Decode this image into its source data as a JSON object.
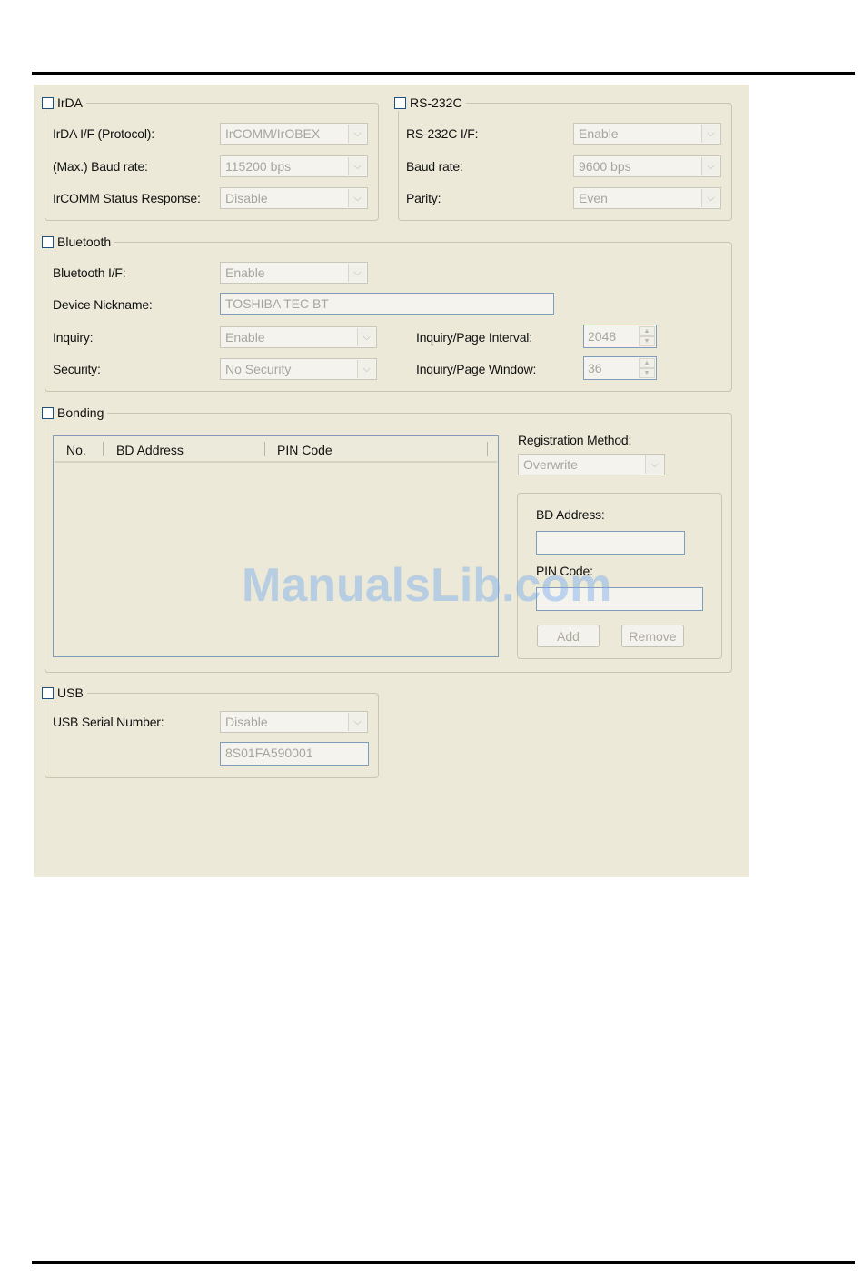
{
  "irda": {
    "title": "IrDA",
    "protocol_label": "IrDA I/F (Protocol):",
    "protocol_value": "IrCOMM/IrOBEX",
    "baud_label": "(Max.) Baud rate:",
    "baud_value": "115200 bps",
    "status_label": "IrCOMM Status Response:",
    "status_value": "Disable"
  },
  "rs232c": {
    "title": "RS-232C",
    "if_label": "RS-232C I/F:",
    "if_value": "Enable",
    "baud_label": "Baud rate:",
    "baud_value": "9600 bps",
    "parity_label": "Parity:",
    "parity_value": "Even"
  },
  "bluetooth": {
    "title": "Bluetooth",
    "if_label": "Bluetooth I/F:",
    "if_value": "Enable",
    "nickname_label": "Device Nickname:",
    "nickname_value": "TOSHIBA TEC BT",
    "inquiry_label": "Inquiry:",
    "inquiry_value": "Enable",
    "security_label": "Security:",
    "security_value": "No Security",
    "interval_label": "Inquiry/Page Interval:",
    "interval_value": "2048",
    "window_label": "Inquiry/Page Window:",
    "window_value": "36"
  },
  "bonding": {
    "title": "Bonding",
    "columns": [
      "No.",
      "BD Address",
      "PIN Code"
    ],
    "registration_label": "Registration Method:",
    "registration_value": "Overwrite",
    "bd_address_label": "BD Address:",
    "pin_code_label": "PIN Code:",
    "add_label": "Add",
    "remove_label": "Remove"
  },
  "usb": {
    "title": "USB",
    "serial_label": "USB Serial Number:",
    "serial_value": "Disable",
    "serial_text": "8S01FA590001"
  },
  "watermark": "ManualsLib.com",
  "colors": {
    "panel_background": "#ece9d8",
    "checkbox_border": "#1c5180",
    "textbox_border": "#7f9db9",
    "disabled_text": "#a7a69e"
  }
}
